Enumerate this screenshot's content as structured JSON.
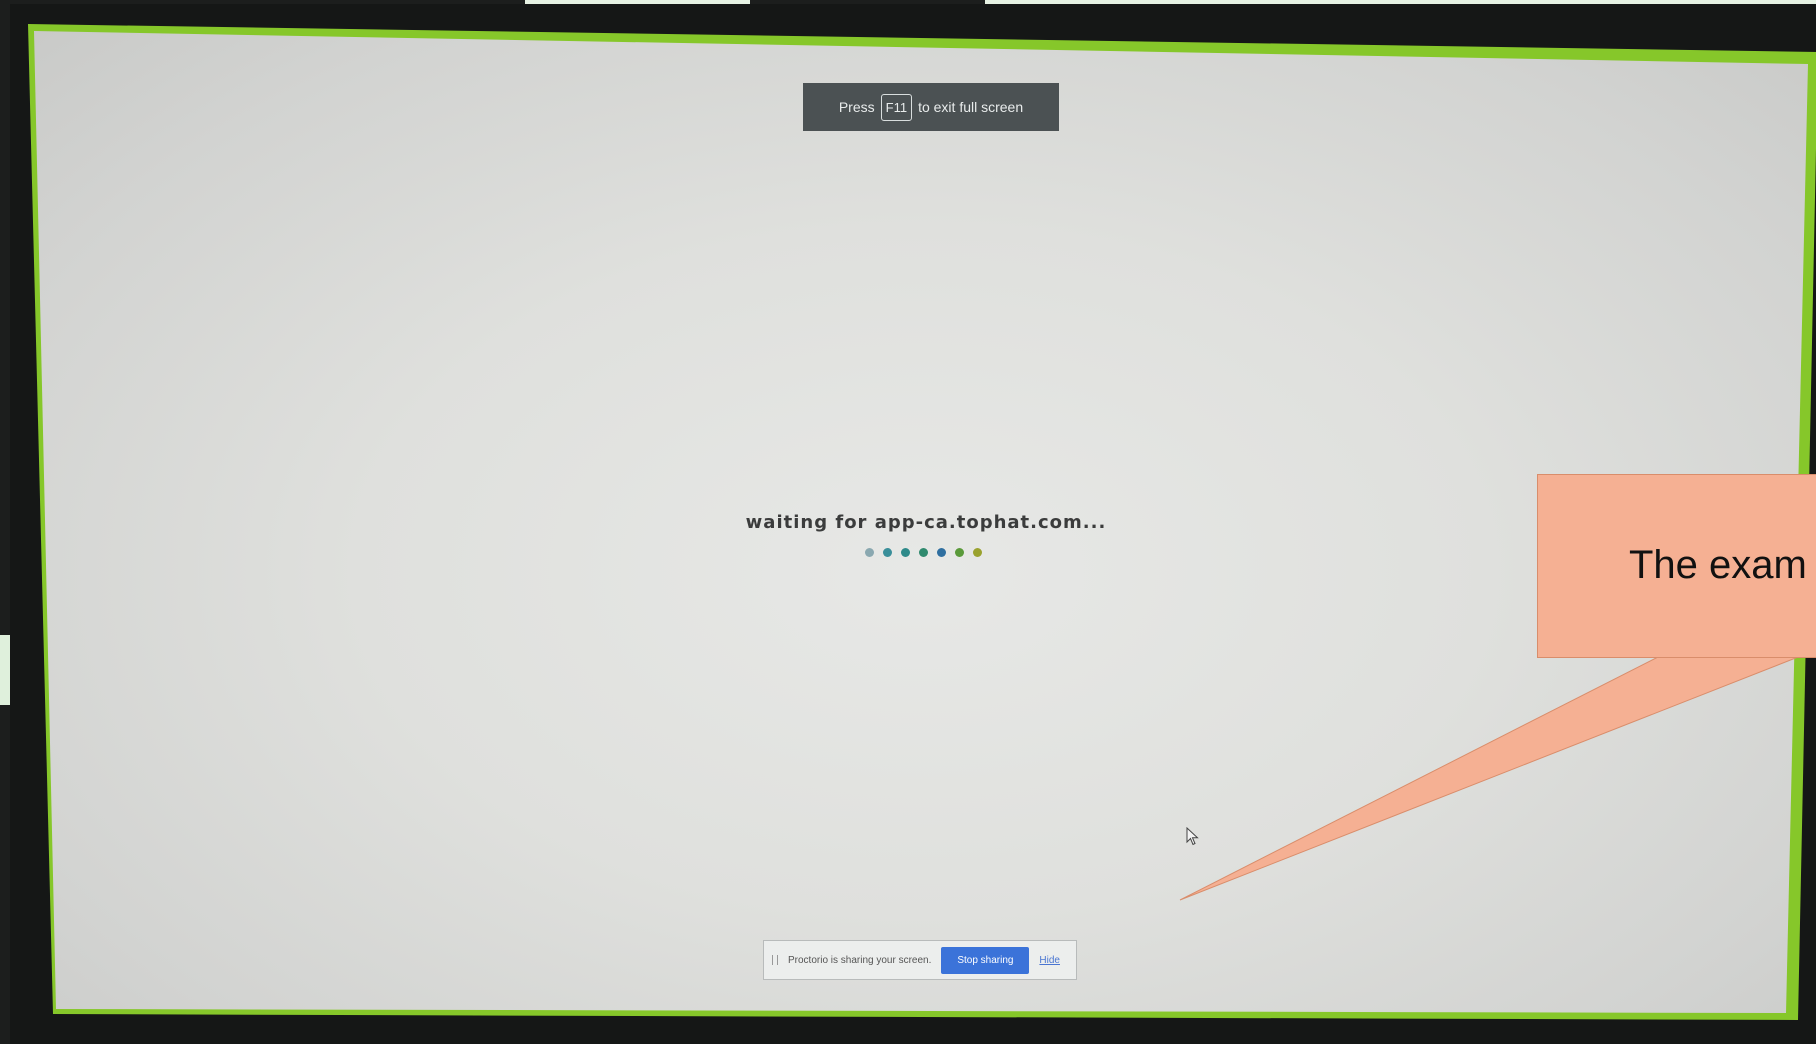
{
  "fullscreen_banner": {
    "prefix": "Press",
    "key": "F11",
    "suffix": "to exit full screen"
  },
  "loading": {
    "message": "waiting for app-ca.tophat.com...",
    "dot_colors": [
      "#8aa8b0",
      "#3a8f9a",
      "#2e8a8a",
      "#2f8a6e",
      "#2f6fa0",
      "#5a9a3a",
      "#9aa22e"
    ]
  },
  "share_bar": {
    "message": "Proctorio is sharing your screen.",
    "stop_label": "Stop sharing",
    "hide_label": "Hide"
  },
  "callout": {
    "text": "The exam"
  },
  "colors": {
    "screen_border": "#86c72a",
    "callout_fill": "#f5b093",
    "stop_button": "#3b73d9"
  }
}
